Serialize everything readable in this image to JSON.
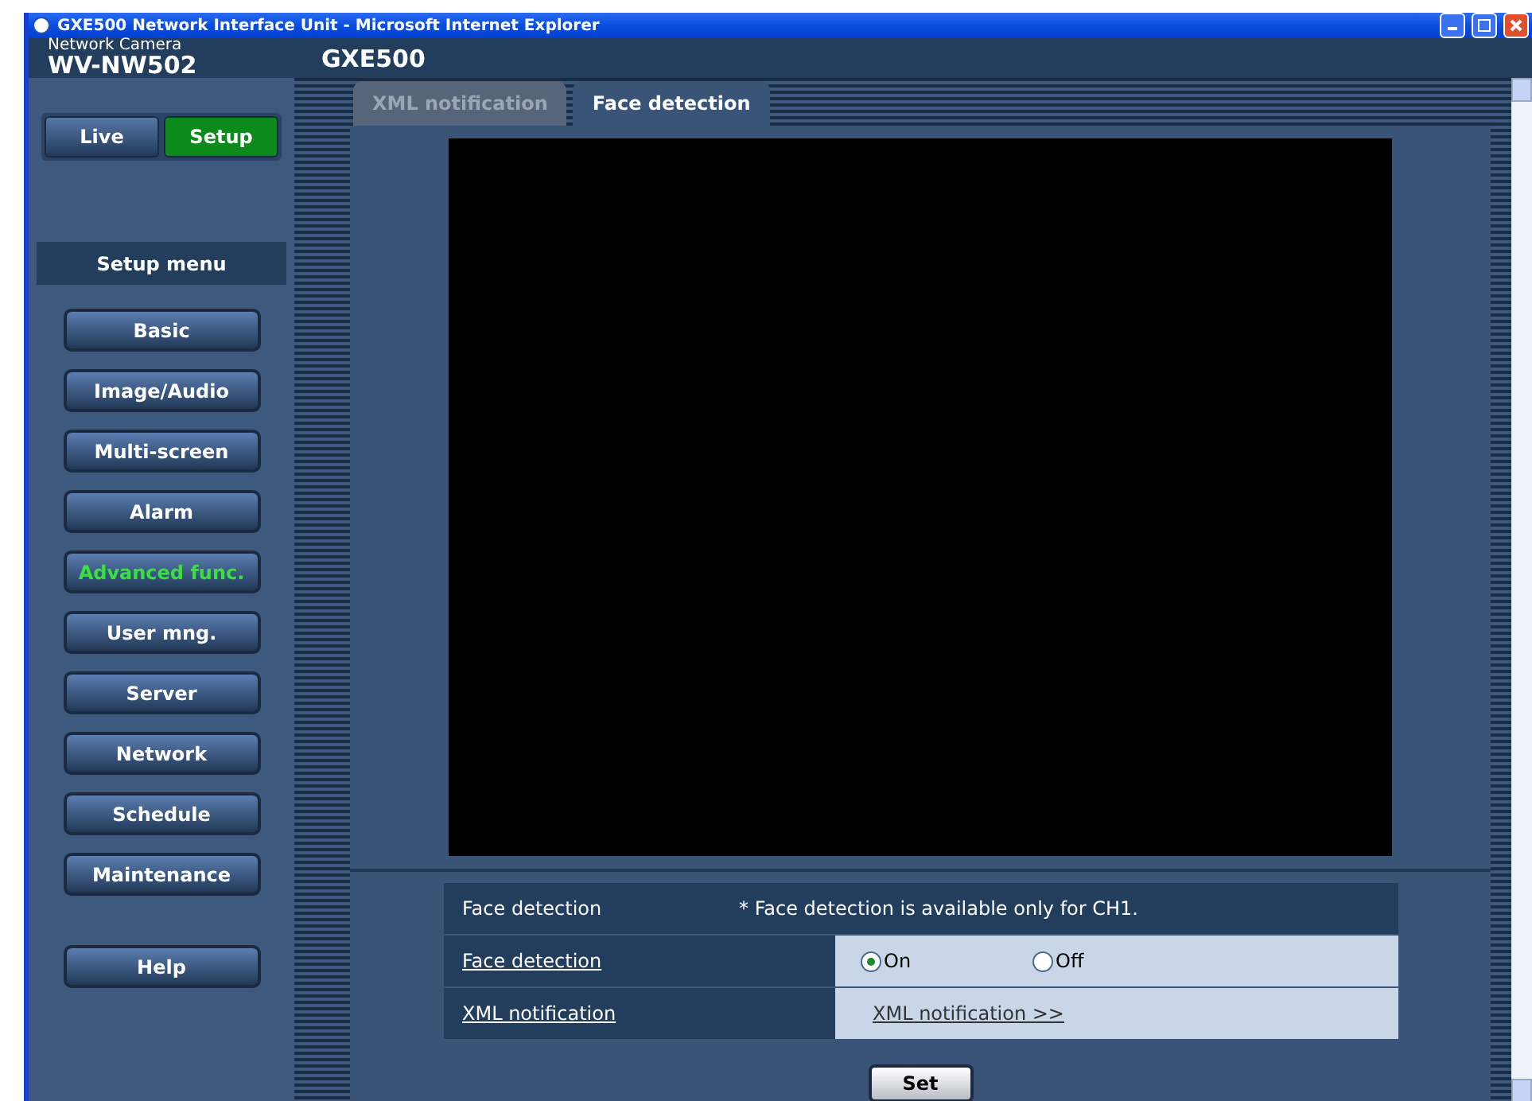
{
  "window": {
    "title": "GXE500 Network Interface Unit - Microsoft Internet Explorer"
  },
  "header": {
    "product_label": "Network Camera",
    "model": "WV-NW502",
    "device": "GXE500"
  },
  "modes": [
    {
      "label": "Live",
      "selected": false
    },
    {
      "label": "Setup",
      "selected": true
    }
  ],
  "setup_menu": {
    "title": "Setup menu",
    "items": [
      {
        "label": "Basic",
        "selected": false
      },
      {
        "label": "Image/Audio",
        "selected": false
      },
      {
        "label": "Multi-screen",
        "selected": false
      },
      {
        "label": "Alarm",
        "selected": false
      },
      {
        "label": "Advanced func.",
        "selected": true
      },
      {
        "label": "User mng.",
        "selected": false
      },
      {
        "label": "Server",
        "selected": false
      },
      {
        "label": "Network",
        "selected": false
      },
      {
        "label": "Schedule",
        "selected": false
      },
      {
        "label": "Maintenance",
        "selected": false
      }
    ],
    "help": "Help"
  },
  "tabs": [
    {
      "label": "XML notification",
      "selected": false
    },
    {
      "label": "Face detection",
      "selected": true
    }
  ],
  "settings": {
    "header": {
      "label": "Face detection",
      "note": "* Face detection is available only for CH1."
    },
    "face_detection": {
      "label": "Face detection",
      "options": [
        {
          "label": "On",
          "selected": true
        },
        {
          "label": "Off",
          "selected": false
        }
      ]
    },
    "xml_notification": {
      "label": "XML notification",
      "link": "XML notification >>"
    }
  },
  "set_button": "Set"
}
